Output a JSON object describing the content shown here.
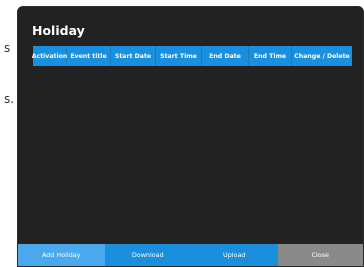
{
  "background": {
    "text_fragments": [
      "s",
      "s."
    ]
  },
  "dialog": {
    "title": "Holiday",
    "table": {
      "columns": [
        "Activation",
        "Event title",
        "Start Date",
        "Start Time",
        "End Date",
        "End Time",
        "Change / Delete"
      ],
      "rows": []
    },
    "footer": {
      "add_label": "Add Holiday",
      "download_label": "Download",
      "upload_label": "Upload",
      "close_label": "Close"
    }
  },
  "colors": {
    "dialog_bg": "#222222",
    "header_bg": "#1a8fde",
    "add_button_bg": "#4aa8ec",
    "close_button_bg": "#8a8a8a"
  }
}
